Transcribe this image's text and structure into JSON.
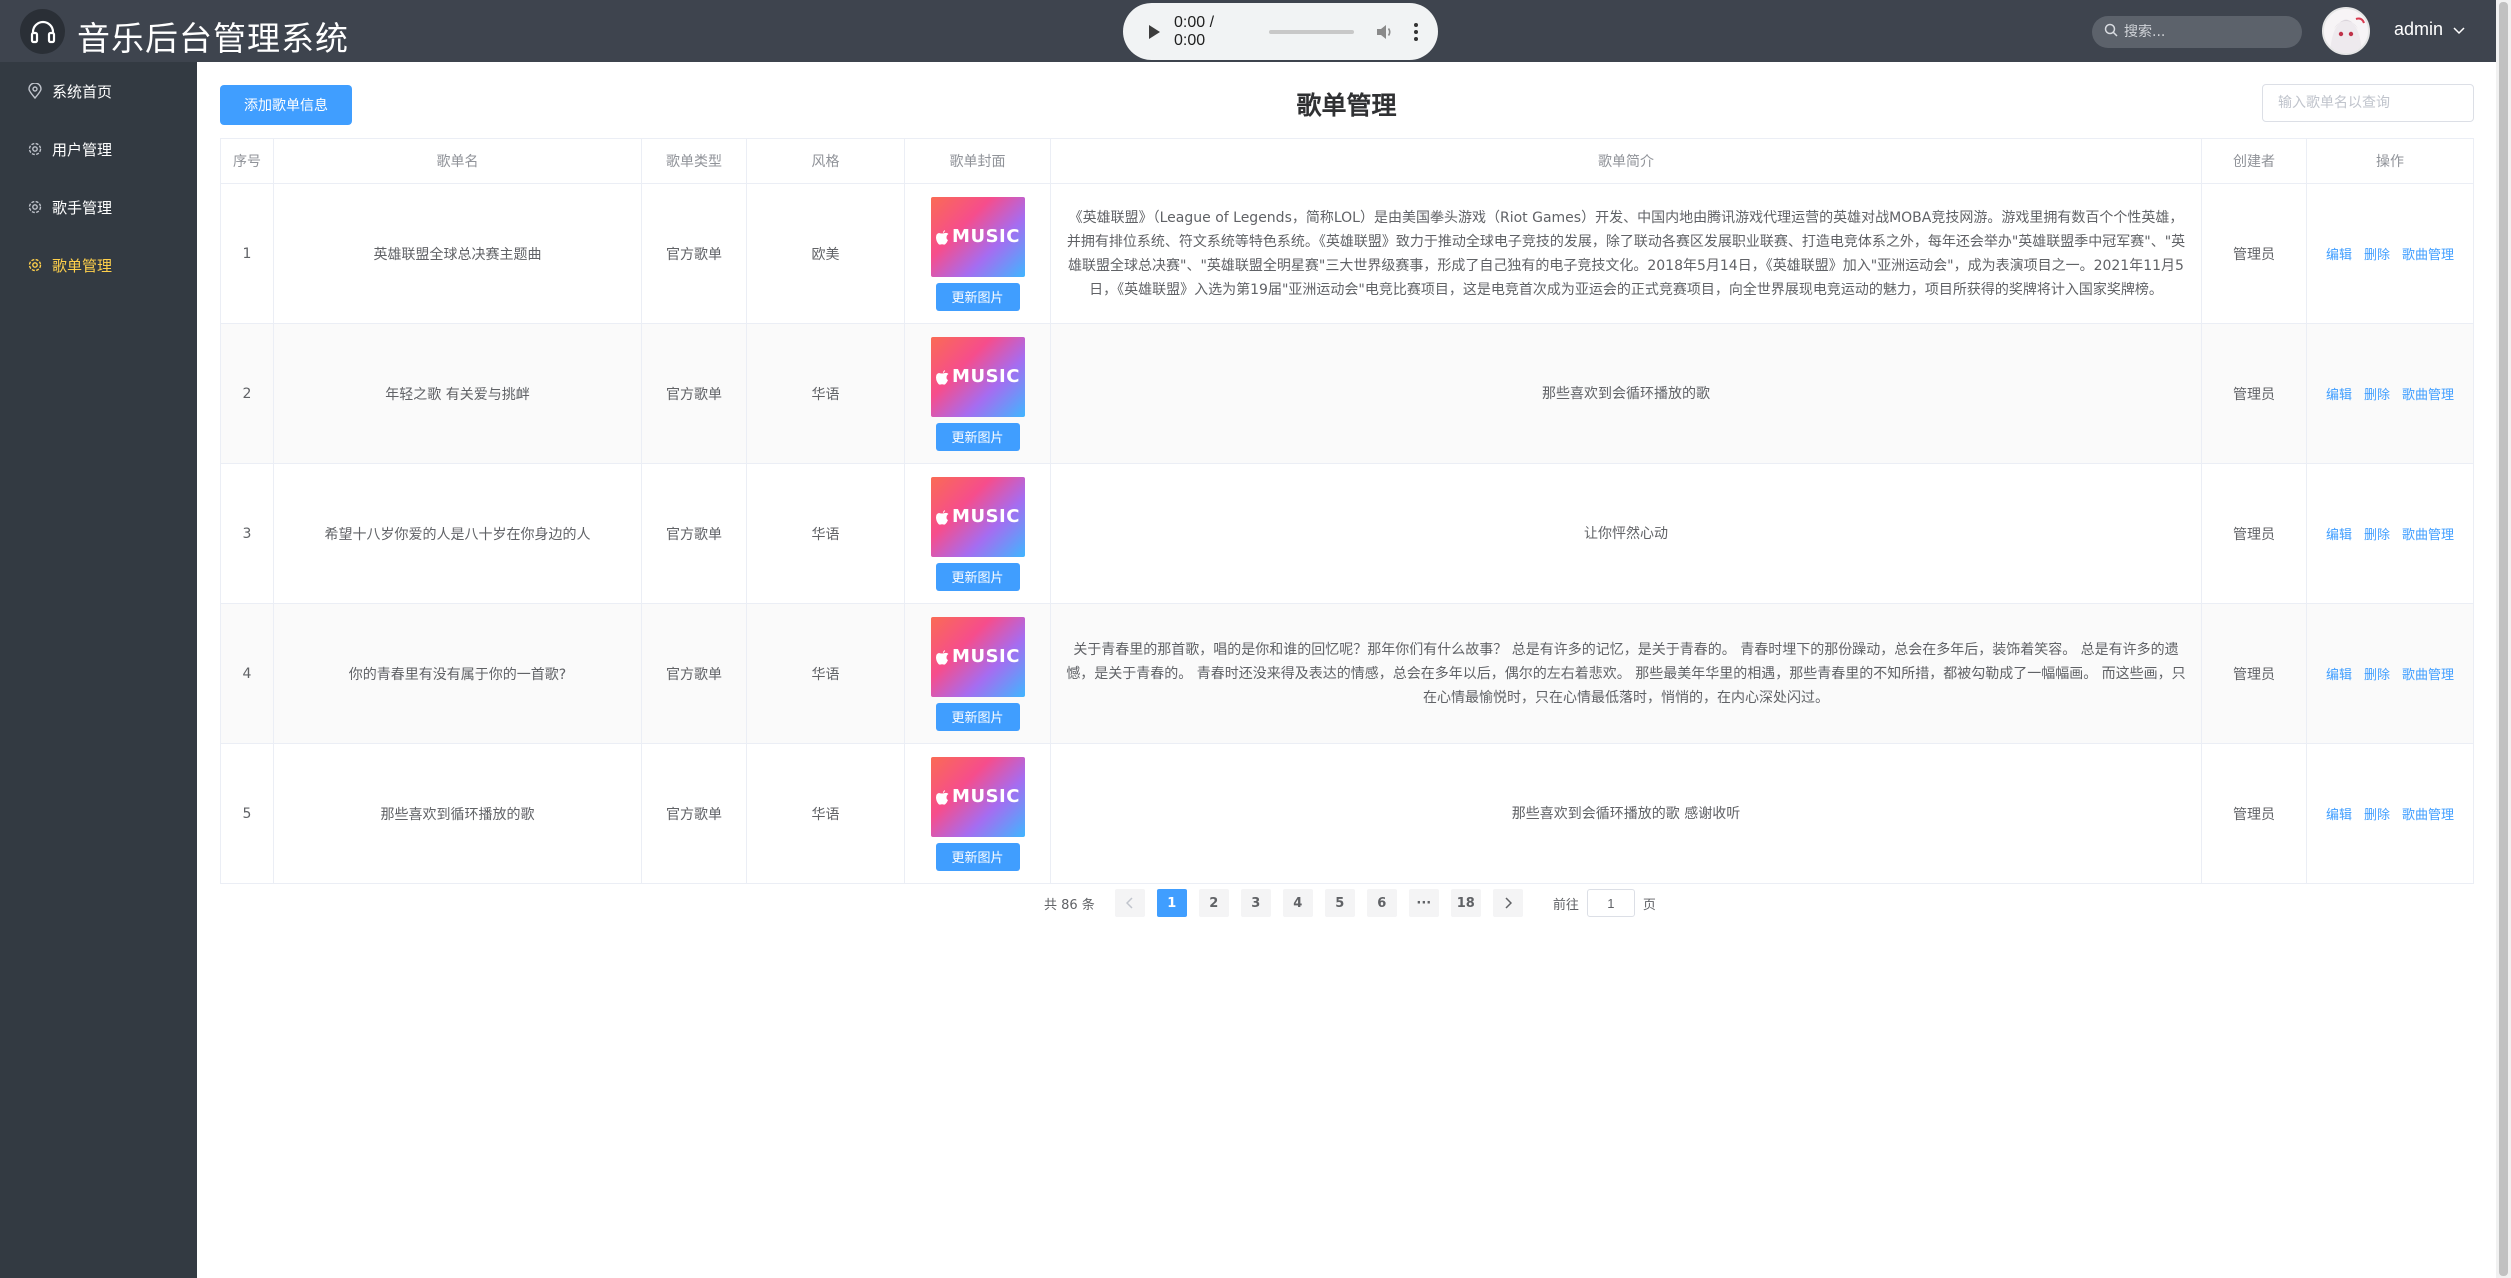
{
  "header": {
    "title": "音乐后台管理系统",
    "audio_time": "0:00 / 0:00",
    "search_placeholder": "搜索...",
    "user_name": "admin"
  },
  "sidebar": {
    "items": [
      {
        "label": "系统首页",
        "icon": "location-icon"
      },
      {
        "label": "用户管理",
        "icon": "gear-icon"
      },
      {
        "label": "歌手管理",
        "icon": "gear-icon"
      },
      {
        "label": "歌单管理",
        "icon": "gear-icon",
        "active": true
      }
    ]
  },
  "main": {
    "add_button": "添加歌单信息",
    "page_title": "歌单管理",
    "query_placeholder": "输入歌单名以查询",
    "columns": [
      "序号",
      "歌单名",
      "歌单类型",
      "风格",
      "歌单封面",
      "歌单简介",
      "创建者",
      "操作"
    ],
    "cover_text": "MUSIC",
    "update_image_label": "更新图片",
    "ops": {
      "edit": "编辑",
      "delete": "删除",
      "song_manage": "歌曲管理"
    },
    "rows": [
      {
        "index": "1",
        "name": "英雄联盟全球总决赛主题曲",
        "type": "官方歌单",
        "style": "欧美",
        "intro": "《英雄联盟》（League of Legends，简称LOL）是由美国拳头游戏（Riot Games）开发、中国内地由腾讯游戏代理运营的英雄对战MOBA竞技网游。游戏里拥有数百个个性英雄，并拥有排位系统、符文系统等特色系统。《英雄联盟》致力于推动全球电子竞技的发展，除了联动各赛区发展职业联赛、打造电竞体系之外，每年还会举办\"英雄联盟季中冠军赛\"、\"英雄联盟全球总决赛\"、\"英雄联盟全明星赛\"三大世界级赛事，形成了自己独有的电子竞技文化。2018年5月14日，《英雄联盟》加入\"亚洲运动会\"，成为表演项目之一。2021年11月5日，《英雄联盟》入选为第19届\"亚洲运动会\"电竞比赛项目，这是电竞首次成为亚运会的正式竞赛项目，向全世界展现电竞运动的魅力，项目所获得的奖牌将计入国家奖牌榜。",
        "creator": "管理员"
      },
      {
        "index": "2",
        "name": "年轻之歌 有关爱与挑衅",
        "type": "官方歌单",
        "style": "华语",
        "intro": "那些喜欢到会循环播放的歌",
        "creator": "管理员"
      },
      {
        "index": "3",
        "name": "希望十八岁你爱的人是八十岁在你身边的人",
        "type": "官方歌单",
        "style": "华语",
        "intro": "让你怦然心动",
        "creator": "管理员"
      },
      {
        "index": "4",
        "name": "你的青春里有没有属于你的一首歌?",
        "type": "官方歌单",
        "style": "华语",
        "intro": "关于青春里的那首歌，唱的是你和谁的回忆呢？那年你们有什么故事？ 总是有许多的记忆，是关于青春的。 青春时埋下的那份躁动，总会在多年后，装饰着笑容。 总是有许多的遗憾，是关于青春的。 青春时还没来得及表达的情感，总会在多年以后，偶尔的左右着悲欢。 那些最美年华里的相遇，那些青春里的不知所措，都被勾勒成了一幅幅画。 而这些画，只在心情最愉悦时，只在心情最低落时，悄悄的，在内心深处闪过。",
        "creator": "管理员"
      },
      {
        "index": "5",
        "name": "那些喜欢到循环播放的歌",
        "type": "官方歌单",
        "style": "华语",
        "intro": "那些喜欢到会循环播放的歌 感谢收听",
        "creator": "管理员"
      }
    ]
  },
  "pagination": {
    "total": "共 86 条",
    "pages": [
      "1",
      "2",
      "3",
      "4",
      "5",
      "6",
      "···",
      "18"
    ],
    "current": "1",
    "goto_label": "前往",
    "goto_value": "1",
    "page_suffix": "页"
  },
  "colors": {
    "header_bg": "#3e444e",
    "sidebar_bg": "#333a42",
    "active_menu": "#ffd04b",
    "primary": "#409eff"
  }
}
